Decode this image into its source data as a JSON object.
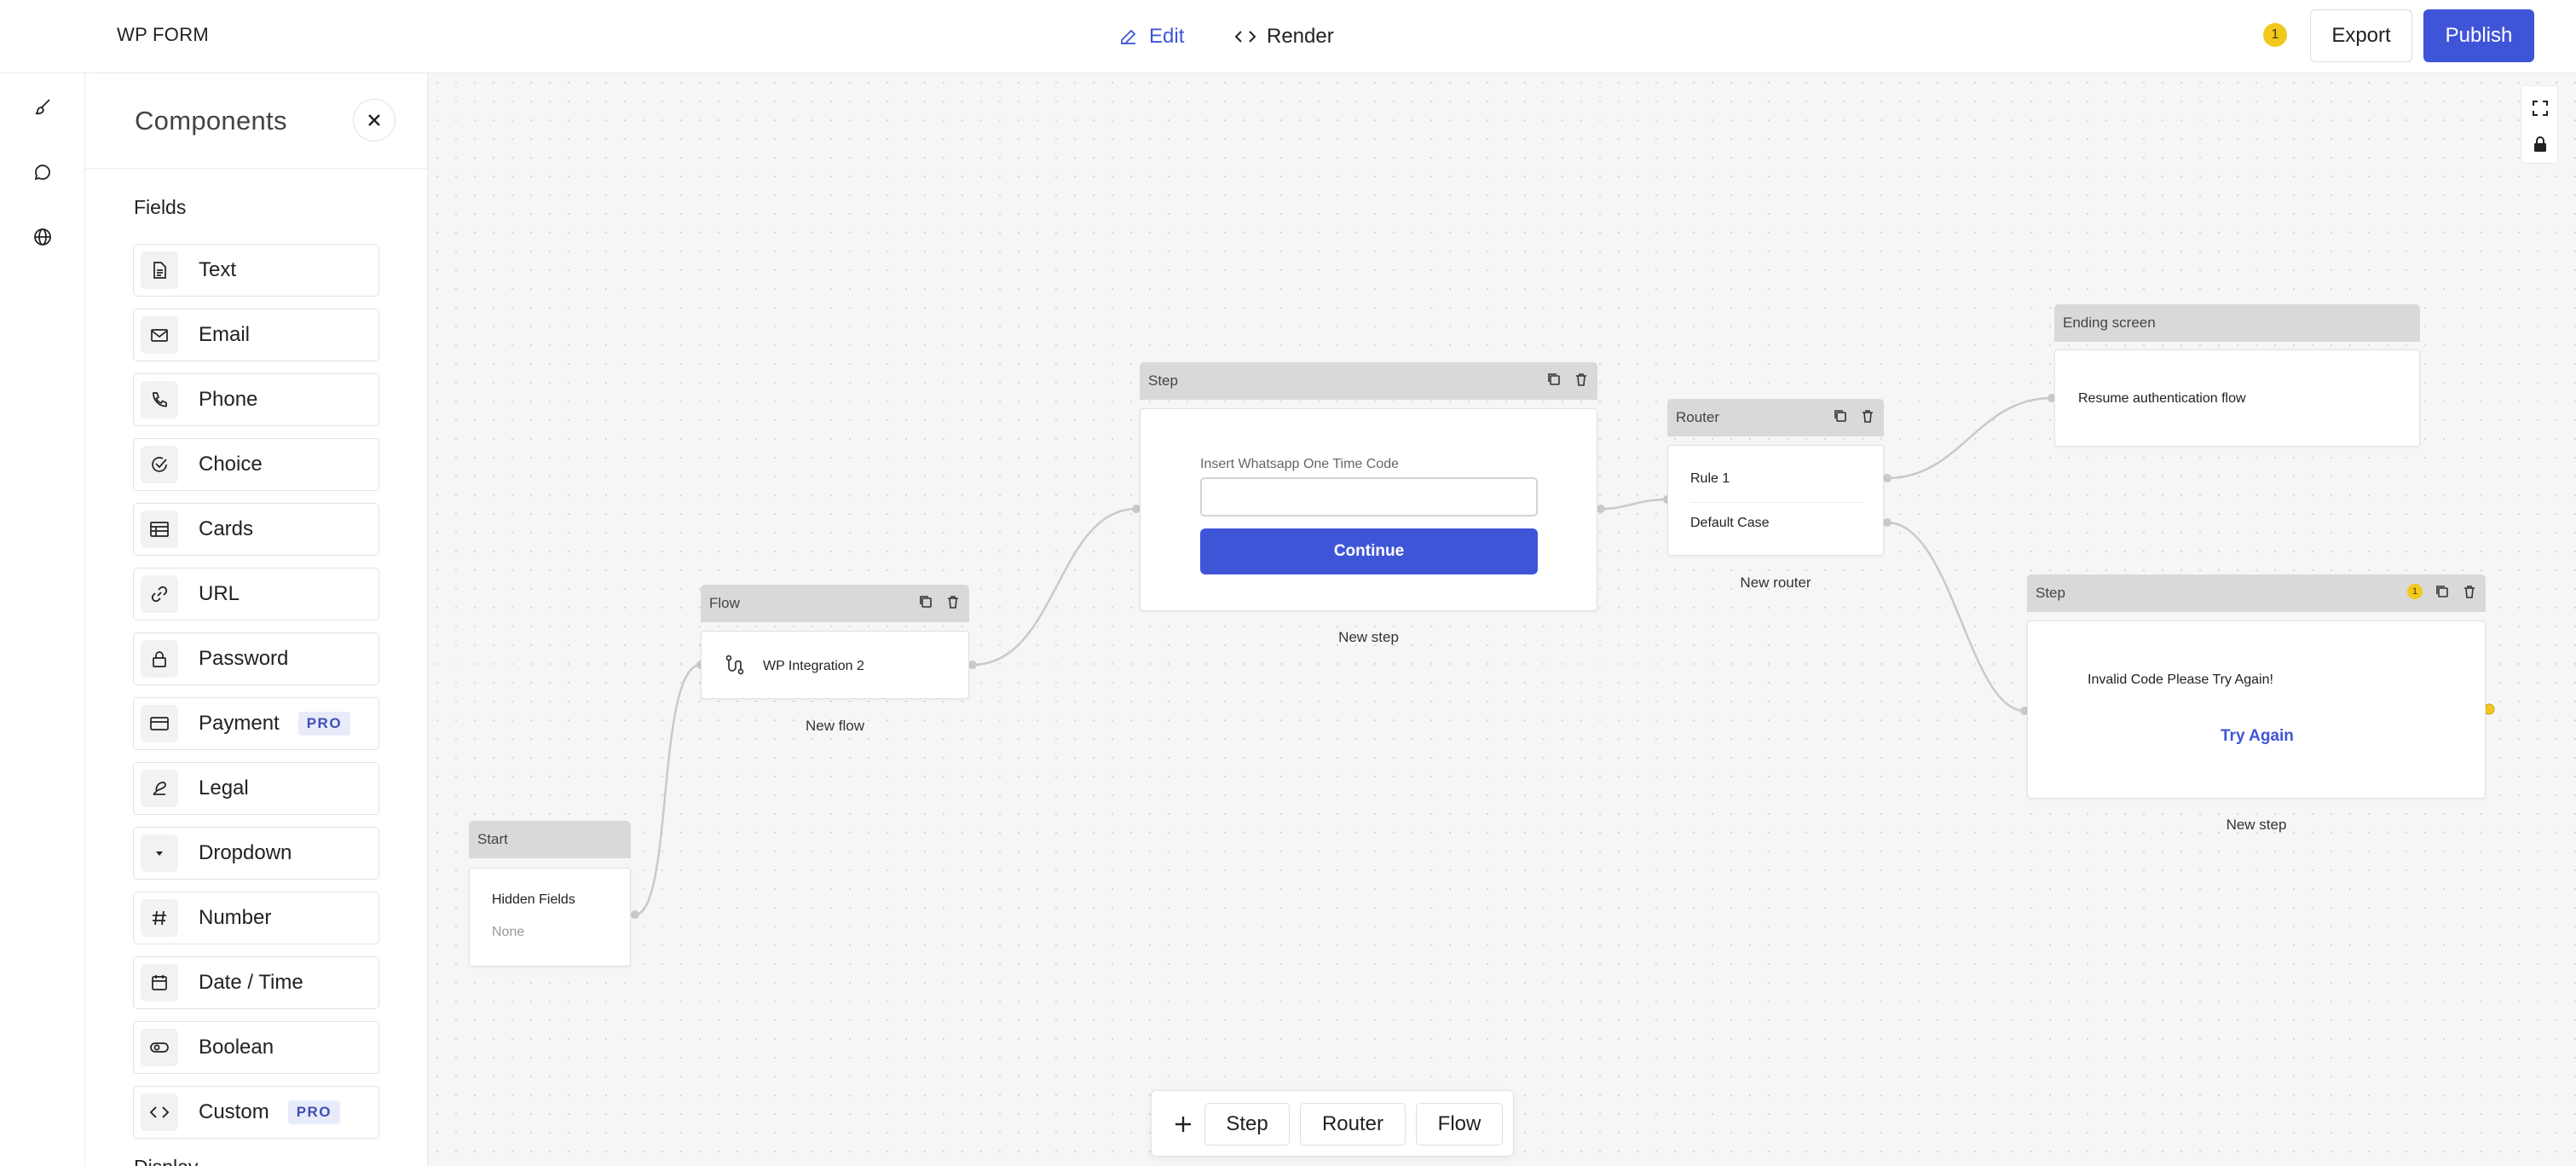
{
  "app": {
    "title": "WP FORM"
  },
  "header": {
    "modes": [
      {
        "label": "Edit",
        "icon": "pencil-icon",
        "active": true
      },
      {
        "label": "Render",
        "icon": "code-icon",
        "active": false
      }
    ],
    "notification_count": "1",
    "export_label": "Export",
    "publish_label": "Publish",
    "accent_color": "#3f55d8"
  },
  "rail": {
    "icons": [
      "apps-grid-icon",
      "brush-icon",
      "chat-bubble-icon",
      "globe-icon"
    ]
  },
  "panel": {
    "title": "Components",
    "section_fields": "Fields",
    "section_next": "Display",
    "fields": [
      {
        "label": "Text",
        "icon": "document-icon",
        "pro": false
      },
      {
        "label": "Email",
        "icon": "envelope-icon",
        "pro": false
      },
      {
        "label": "Phone",
        "icon": "phone-icon",
        "pro": false
      },
      {
        "label": "Choice",
        "icon": "check-circle-icon",
        "pro": false
      },
      {
        "label": "Cards",
        "icon": "table-icon",
        "pro": false
      },
      {
        "label": "URL",
        "icon": "link-icon",
        "pro": false
      },
      {
        "label": "Password",
        "icon": "lock-icon",
        "pro": false
      },
      {
        "label": "Payment",
        "icon": "credit-card-icon",
        "pro": true
      },
      {
        "label": "Legal",
        "icon": "signature-icon",
        "pro": false
      },
      {
        "label": "Dropdown",
        "icon": "caret-down-icon",
        "pro": false
      },
      {
        "label": "Number",
        "icon": "hash-icon",
        "pro": false
      },
      {
        "label": "Date / Time",
        "icon": "calendar-icon",
        "pro": false
      },
      {
        "label": "Boolean",
        "icon": "toggle-icon",
        "pro": false
      },
      {
        "label": "Custom",
        "icon": "code-icon",
        "pro": true
      }
    ],
    "pro_label": "PRO"
  },
  "canvas": {
    "start": {
      "header": "Start",
      "title": "Hidden Fields",
      "value": "None"
    },
    "flow": {
      "header": "Flow",
      "item": "WP Integration 2",
      "caption": "New flow"
    },
    "step1": {
      "header": "Step",
      "field_label": "Insert Whatsapp One Time Code",
      "field_value": "",
      "button": "Continue",
      "caption": "New step"
    },
    "router": {
      "header": "Router",
      "rules": [
        "Rule 1",
        "Default Case"
      ],
      "caption": "New router"
    },
    "ending": {
      "header": "Ending screen",
      "text": "Resume authentication flow"
    },
    "step2": {
      "header": "Step",
      "badge": "1",
      "text": "Invalid Code Please Try Again!",
      "link": "Try Again",
      "caption": "New step"
    }
  },
  "bottombar": {
    "add_icon": "plus-icon",
    "buttons": [
      "Step",
      "Router",
      "Flow"
    ]
  }
}
